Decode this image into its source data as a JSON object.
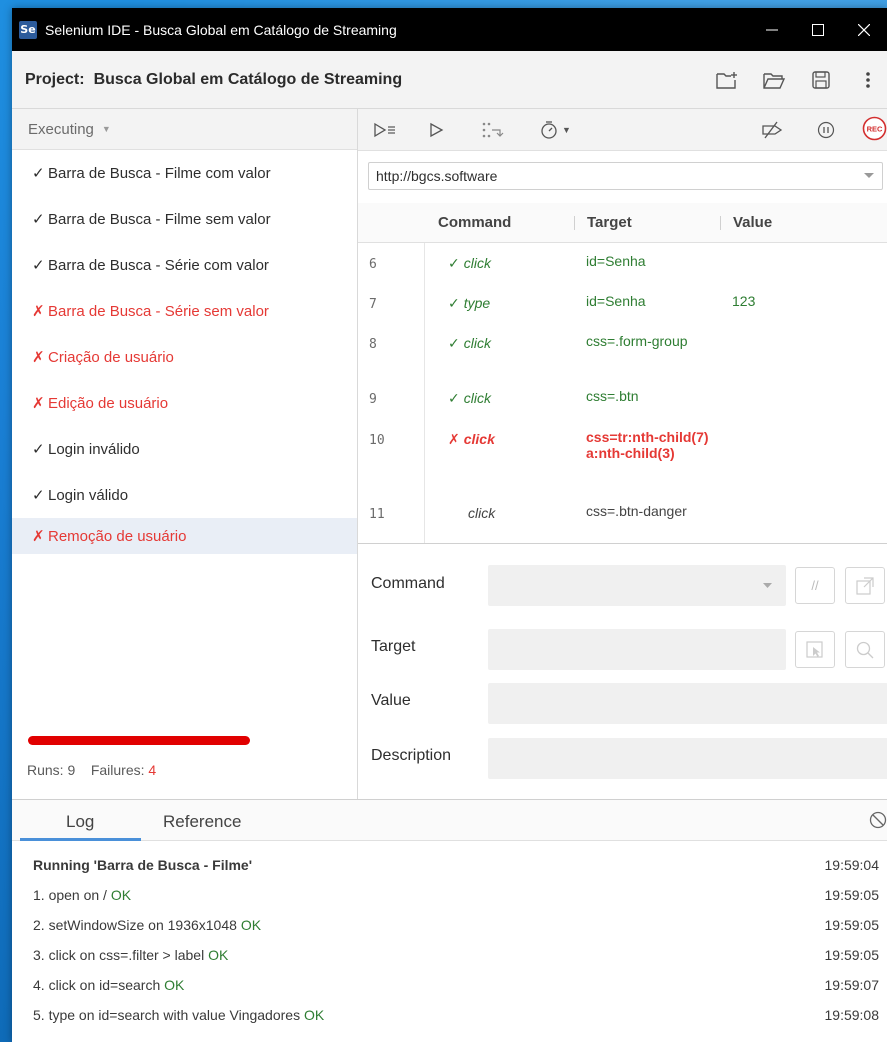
{
  "window": {
    "app_icon": "Se",
    "title": "Selenium IDE - Busca Global em Catálogo de Streaming"
  },
  "project": {
    "label": "Project:",
    "name": "Busca Global em Catálogo de Streaming",
    "icons": [
      "new-folder-icon",
      "open-folder-icon",
      "save-icon",
      "more-options-icon"
    ]
  },
  "left": {
    "mode": "Executing",
    "tests": [
      {
        "name": "Barra de Busca - Filme com valor",
        "status": "pass"
      },
      {
        "name": "Barra de Busca - Filme sem valor",
        "status": "pass"
      },
      {
        "name": "Barra de Busca - Série com valor",
        "status": "pass"
      },
      {
        "name": "Barra de Busca - Série sem valor",
        "status": "fail"
      },
      {
        "name": "Criação de usuário",
        "status": "fail"
      },
      {
        "name": "Edição de usuário",
        "status": "fail"
      },
      {
        "name": "Login inválido",
        "status": "pass"
      },
      {
        "name": "Login válido",
        "status": "pass"
      },
      {
        "name": "Remoção de usuário",
        "status": "fail"
      }
    ],
    "marks": {
      "pass": "✓",
      "fail": "✗"
    },
    "progress": 1.0,
    "progress_color": "#e10000",
    "runs_label": "Runs:",
    "runs": "9",
    "failures_label": "Failures:",
    "failures": "4"
  },
  "toolbar": {
    "icons": [
      "run-all-icon",
      "run-icon",
      "step-icon",
      "speed-icon",
      "disable-breakpoints-icon",
      "pause-icon",
      "record-icon"
    ],
    "record_label": "REC"
  },
  "editor": {
    "base_url": "http://bgcs.software",
    "columns": {
      "command": "Command",
      "target": "Target",
      "value": "Value"
    },
    "commands": [
      {
        "num": "6",
        "command": "click",
        "target": "id=Senha",
        "value": "",
        "status": "pass"
      },
      {
        "num": "7",
        "command": "type",
        "target": "id=Senha",
        "value": "123",
        "status": "pass"
      },
      {
        "num": "8",
        "command": "click",
        "target": "css=.form-group",
        "value": "",
        "status": "pass"
      },
      {
        "num": "9",
        "command": "click",
        "target": "css=.btn",
        "value": "",
        "status": "pass"
      },
      {
        "num": "10",
        "command": "click",
        "target": "css=tr:nth-child(7) a:nth-child(3)",
        "value": "",
        "status": "fail"
      },
      {
        "num": "11",
        "command": "click",
        "target": "css=.btn-danger",
        "value": "",
        "status": "pending"
      }
    ],
    "form": {
      "command_label": "Command",
      "target_label": "Target",
      "value_label": "Value",
      "description_label": "Description",
      "comment_btn": "//"
    }
  },
  "log": {
    "tab_log": "Log",
    "tab_reference": "Reference",
    "lines": [
      {
        "text": "Running 'Barra de Busca - Filme'",
        "ok": "",
        "time": "19:59:04",
        "head": true
      },
      {
        "text": "1.  open on /",
        "ok": "OK",
        "time": "19:59:05",
        "head": false
      },
      {
        "text": "2.  setWindowSize on 1936x1048",
        "ok": "OK",
        "time": "19:59:05",
        "head": false
      },
      {
        "text": "3.  click on css=.filter > label",
        "ok": "OK",
        "time": "19:59:05",
        "head": false
      },
      {
        "text": "4.  click on id=search",
        "ok": "OK",
        "time": "19:59:07",
        "head": false
      },
      {
        "text": "5.  type on id=search with value Vingadores",
        "ok": "OK",
        "time": "19:59:08",
        "head": false
      }
    ]
  }
}
